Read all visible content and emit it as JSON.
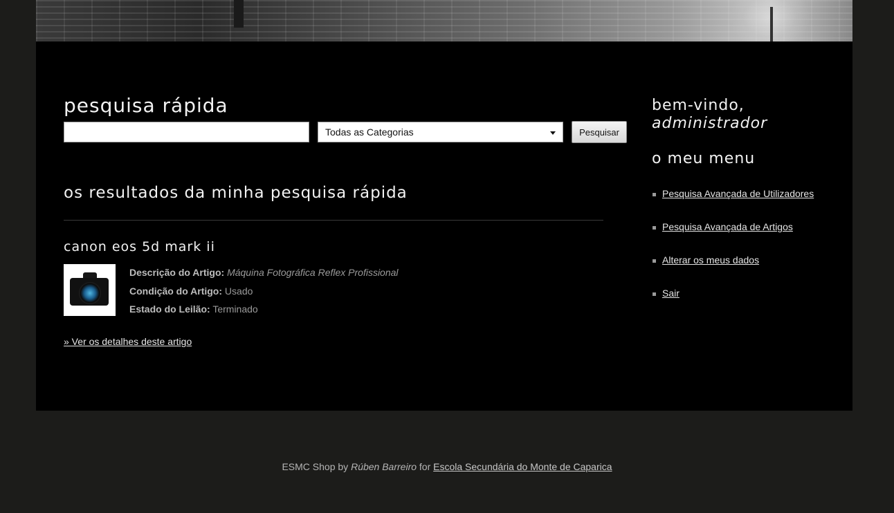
{
  "search": {
    "title": "pesquisa rápida",
    "input_value": "",
    "category_selected": "Todas as Categorias",
    "button_label": "Pesquisar"
  },
  "results": {
    "title": "os resultados da minha pesquisa rápida",
    "items": [
      {
        "name": "canon eos 5d mark ii",
        "description_label": "Descrição do Artigo:",
        "description_value": "Máquina Fotográfica Reflex Profissional",
        "condition_label": "Condição do Artigo:",
        "condition_value": "Usado",
        "status_label": "Estado do Leilão:",
        "status_value": "Terminado",
        "details_link": "» Ver os detalhes deste artigo"
      }
    ]
  },
  "sidebar": {
    "welcome_line1": "bem-vindo,",
    "welcome_user": "administrador",
    "menu_title": "o meu menu",
    "menu_items": [
      {
        "label": "Pesquisa Avançada de Utilizadores"
      },
      {
        "label": "Pesquisa Avançada de Artigos"
      },
      {
        "label": "Alterar os meus dados"
      },
      {
        "label": "Sair"
      }
    ]
  },
  "footer": {
    "prefix": "ESMC Shop by",
    "author": "Rúben Barreiro",
    "middle": "for",
    "school_link": "Escola Secundária do Monte de Caparica"
  }
}
